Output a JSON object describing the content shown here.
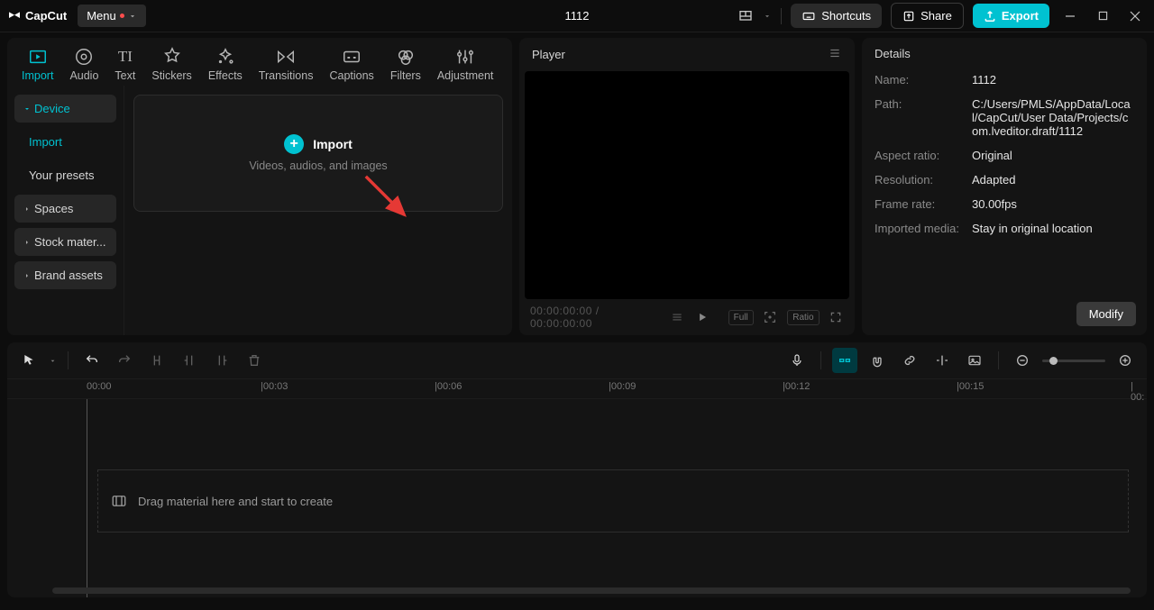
{
  "titlebar": {
    "app": "CapCut",
    "menu": "Menu",
    "project": "1112",
    "shortcuts": "Shortcuts",
    "share": "Share",
    "export": "Export"
  },
  "tabs": {
    "import": "Import",
    "audio": "Audio",
    "text": "Text",
    "stickers": "Stickers",
    "effects": "Effects",
    "transitions": "Transitions",
    "captions": "Captions",
    "filters": "Filters",
    "adjustment": "Adjustment"
  },
  "sidebar": {
    "device": "Device",
    "import": "Import",
    "presets": "Your presets",
    "spaces": "Spaces",
    "stock": "Stock mater...",
    "brand": "Brand assets"
  },
  "import_area": {
    "title": "Import",
    "sub": "Videos, audios, and images"
  },
  "player": {
    "title": "Player",
    "tc_current": "00:00:00:00",
    "tc_sep": " / ",
    "tc_total": "00:00:00:00",
    "full": "Full",
    "ratio": "Ratio"
  },
  "details": {
    "title": "Details",
    "name_l": "Name:",
    "name_v": "1112",
    "path_l": "Path:",
    "path_v": "C:/Users/PMLS/AppData/Local/CapCut/User Data/Projects/com.lveditor.draft/1112",
    "ar_l": "Aspect ratio:",
    "ar_v": "Original",
    "res_l": "Resolution:",
    "res_v": "Adapted",
    "fr_l": "Frame rate:",
    "fr_v": "30.00fps",
    "media_l": "Imported media:",
    "media_v": "Stay in original location",
    "modify": "Modify"
  },
  "ruler": {
    "t0": "00:00",
    "t3": "|00:03",
    "t6": "|00:06",
    "t9": "|00:09",
    "t12": "|00:12",
    "t15": "|00:15",
    "t18": "| 00:"
  },
  "timeline": {
    "drop": "Drag material here and start to create"
  }
}
